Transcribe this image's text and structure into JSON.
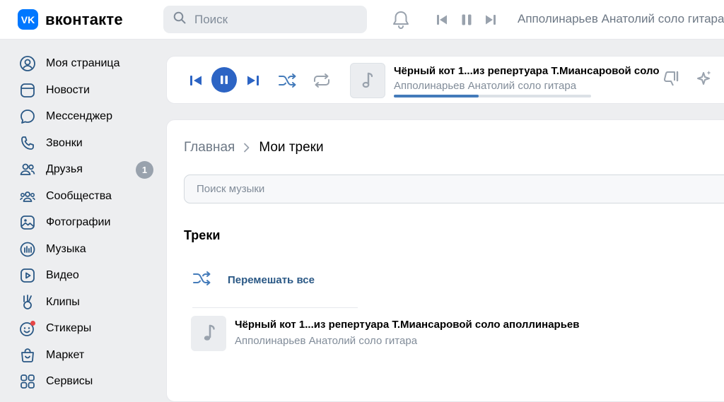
{
  "header": {
    "logo_glyph": "VK",
    "logo_text": "вконтакте",
    "search_placeholder": "Поиск",
    "now_playing": "Апполинарьев Анатолий соло гитара"
  },
  "sidebar": {
    "items": [
      {
        "label": "Моя страница",
        "icon": "profile-icon"
      },
      {
        "label": "Новости",
        "icon": "news-icon"
      },
      {
        "label": "Мессенджер",
        "icon": "messenger-icon"
      },
      {
        "label": "Звонки",
        "icon": "phone-icon"
      },
      {
        "label": "Друзья",
        "icon": "friends-icon",
        "badge": "1"
      },
      {
        "label": "Сообщества",
        "icon": "communities-icon"
      },
      {
        "label": "Фотографии",
        "icon": "photos-icon"
      },
      {
        "label": "Музыка",
        "icon": "music-icon"
      },
      {
        "label": "Видео",
        "icon": "video-icon"
      },
      {
        "label": "Клипы",
        "icon": "clips-icon"
      },
      {
        "label": "Стикеры",
        "icon": "stickers-icon"
      },
      {
        "label": "Маркет",
        "icon": "market-icon"
      },
      {
        "label": "Сервисы",
        "icon": "services-icon"
      }
    ]
  },
  "player": {
    "title": "Чёрный кот 1...из репертуара Т.Миансаровой соло",
    "artist": "Апполинарьев Анатолий соло гитара",
    "progress": 0.43
  },
  "main": {
    "breadcrumb_home": "Главная",
    "breadcrumb_current": "Мои треки",
    "search_placeholder": "Поиск музыки",
    "section_title": "Треки",
    "shuffle_label": "Перемешать все",
    "tracks": [
      {
        "title": "Чёрный кот 1...из репертуара Т.Миансаровой соло аполлинарьев",
        "artist": "Апполинарьев Анатолий соло гитара"
      }
    ]
  },
  "colors": {
    "accent": "#0077ff",
    "play_button": "#2c64c4",
    "icon_blue": "#2a5885",
    "text_secondary": "#818c99",
    "badge": "#99a2ad",
    "notification_dot": "#e64646"
  }
}
